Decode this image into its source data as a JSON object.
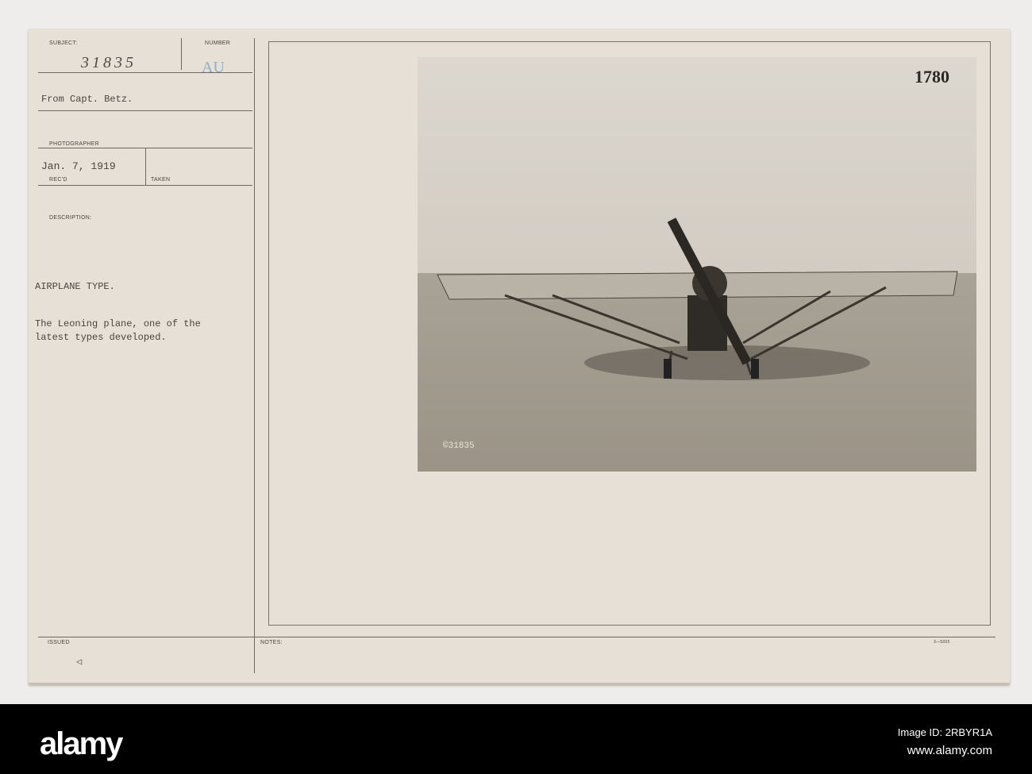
{
  "card": {
    "subject_label": "SUBJECT:",
    "subject_number": "31835",
    "number_label": "NUMBER",
    "number_stamp": "AU",
    "from": "From Capt. Betz.",
    "photographer_label": "PHOTOGRAPHER",
    "date": "Jan. 7, 1919",
    "recd_label": "REC'D",
    "taken_label": "TAKEN",
    "description_label": "DESCRIPTION:",
    "title": "AIRPLANE TYPE.",
    "description_line1": "The Leoning plane, one of the",
    "description_line2": "latest types developed.",
    "issued_label": "ISSUED",
    "issued_mark": "◁",
    "notes_label": "NOTES:",
    "form_code": "3—5005"
  },
  "photo": {
    "corner_number": "1780",
    "negative_number": "©31835"
  },
  "footer": {
    "logo": "alamy",
    "image_id": "Image ID: 2RBYR1A",
    "website": "www.alamy.com"
  }
}
